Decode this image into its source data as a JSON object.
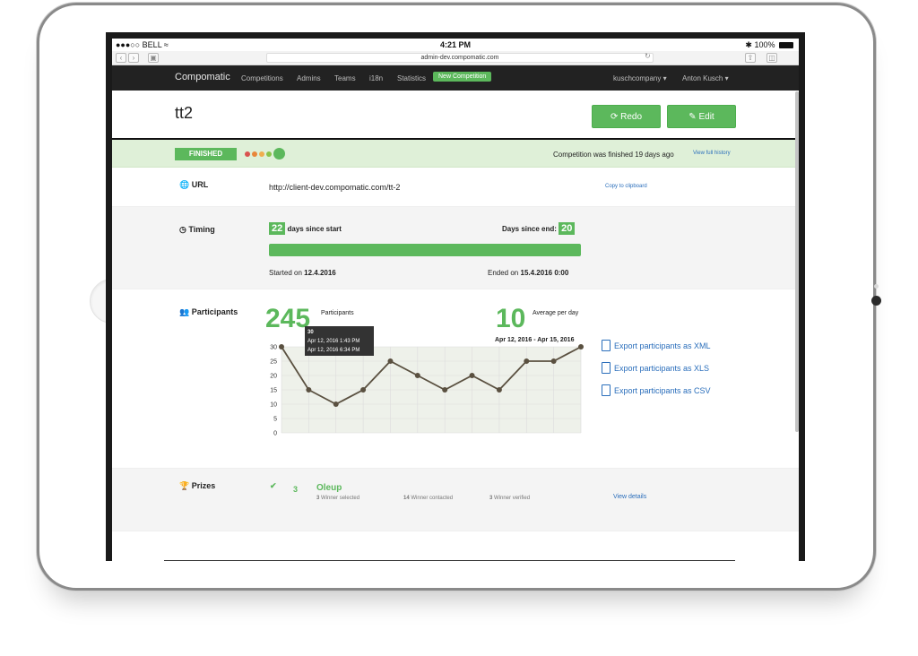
{
  "status_bar": {
    "carrier": "●●●○○ BELL",
    "time": "4:21 PM",
    "battery": "100%"
  },
  "browser": {
    "url": "admin-dev.compomatic.com"
  },
  "nav": {
    "brand": "Compomatic",
    "items": [
      "Competitions",
      "Admins",
      "Teams",
      "i18n",
      "Statistics"
    ],
    "new_competition": "New Competition",
    "company": "kuschcompany ▾",
    "user": "Anton Kusch ▾"
  },
  "page": {
    "title": "tt2",
    "redo_label": "Redo",
    "edit_label": "Edit"
  },
  "status": {
    "badge": "FINISHED",
    "message": "Competition was finished 19 days ago",
    "history_link": "View full history",
    "dot_colors": [
      "#d9534f",
      "#e8863a",
      "#f0ad4e",
      "#8bc34a",
      "#5cb85c"
    ]
  },
  "url_section": {
    "label": "URL",
    "value": "http://client-dev.compomatic.com/tt-2",
    "copy_link": "Copy to clipboard"
  },
  "timing": {
    "label": "Timing",
    "days_since_start": "22",
    "days_since_start_text": "days since start",
    "days_since_end_label": "Days since end:",
    "days_since_end": "20",
    "started_prefix": "Started on",
    "started_date": "12.4.2016",
    "ended_prefix": "Ended on",
    "ended_date": "15.4.2016 0:00",
    "progress": 1.0
  },
  "participants": {
    "label": "Participants",
    "total": "245",
    "total_caption": "Participants",
    "avg": "10",
    "avg_caption": "Average per day",
    "date_range": "Apr 12, 2016 - Apr 15, 2016",
    "exports": [
      "Export participants as XML",
      "Export participants as XLS",
      "Export participants as CSV"
    ],
    "tooltip": {
      "value": "30",
      "line1": "Apr 12, 2016 1:43 PM",
      "line2": "Apr 12, 2016 6:34 PM"
    }
  },
  "chart_data": {
    "type": "line",
    "x": [
      1,
      2,
      3,
      4,
      5,
      6,
      7,
      8,
      9,
      10,
      11,
      12
    ],
    "values": [
      30,
      15,
      10,
      15,
      25,
      20,
      15,
      20,
      15,
      25,
      25,
      30
    ],
    "yticks": [
      "0",
      "5",
      "10",
      "15",
      "20",
      "25",
      "30"
    ],
    "ylim": [
      0,
      30
    ],
    "grid": true,
    "line_color": "#5a5040",
    "fill_color": "#eef1ea"
  },
  "prizes": {
    "label": "Prizes",
    "count": "3",
    "name": "Oleup",
    "stats": [
      {
        "num": "3",
        "text": "Winner selected"
      },
      {
        "num": "14",
        "text": "Winner contacted"
      },
      {
        "num": "3",
        "text": "Winner verified"
      }
    ],
    "details_link": "View details"
  }
}
